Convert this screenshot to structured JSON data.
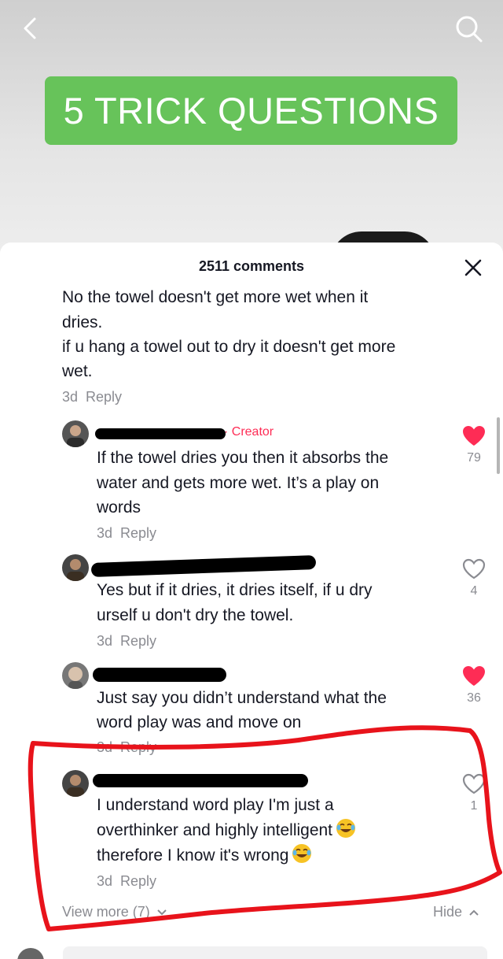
{
  "video": {
    "banner_text": "5 TRICK QUESTIONS"
  },
  "icons": {
    "back": "chevron-left-icon",
    "search": "search-icon",
    "close": "close-icon",
    "heart": "heart-icon"
  },
  "colors": {
    "banner_green": "#67c35a",
    "like_red": "#fe2c55",
    "annotation_red": "#e8131b",
    "muted": "#8a8b91"
  },
  "comments_sheet": {
    "count_label": "2511 comments",
    "comments": [
      {
        "text_lines": [
          "No the towel doesn't get more wet when it",
          "dries.",
          "if u hang a towel out to dry it doesn't get more",
          "wet."
        ],
        "time": "3d",
        "reply": "Reply"
      },
      {
        "badge": "· Creator",
        "text_lines": [
          "If the towel dries you then it absorbs the",
          "water and gets more wet. It’s a play on",
          "words"
        ],
        "time": "3d",
        "reply": "Reply",
        "likes": "79",
        "liked": true
      },
      {
        "text_lines": [
          "Yes but if it dries, it dries itself, if u dry",
          "urself u don't dry the towel."
        ],
        "time": "3d",
        "reply": "Reply",
        "likes": "4",
        "liked": false
      },
      {
        "text_lines": [
          "Just say you didn’t understand what the",
          "word play was and move on"
        ],
        "time": "3d",
        "reply": "Reply",
        "likes": "36",
        "liked": true
      },
      {
        "text_lines": [
          "I understand word play I'm just a",
          "overthinker and highly intelligent",
          "therefore I know it's wrong"
        ],
        "emoji": "😂",
        "time": "3d",
        "reply": "Reply",
        "likes": "1",
        "liked": false
      }
    ],
    "view_more": "View more (7)",
    "hide": "Hide"
  }
}
